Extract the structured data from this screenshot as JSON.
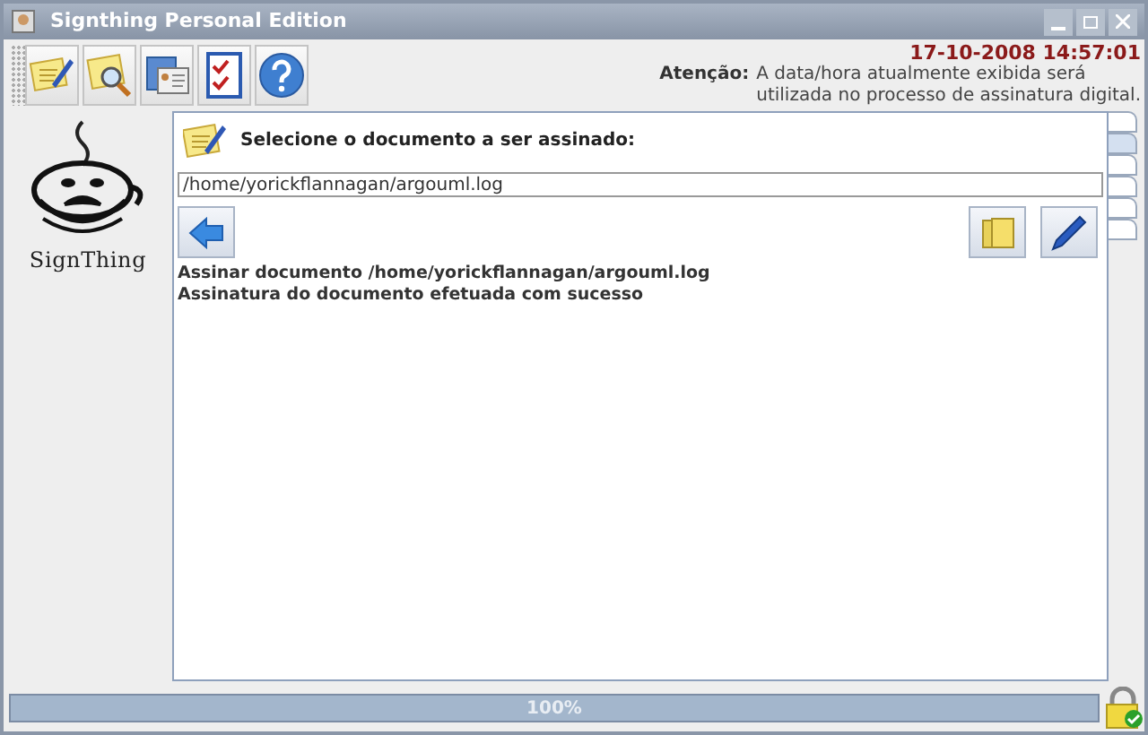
{
  "window": {
    "title": "Signthing Personal Edition"
  },
  "toolbar": [
    {
      "kind": "edit"
    },
    {
      "kind": "search"
    },
    {
      "kind": "cards"
    },
    {
      "kind": "checklist"
    },
    {
      "kind": "help"
    }
  ],
  "header": {
    "datetime": "17-10-2008 14:57:01",
    "notice_label": "Atenção:",
    "notice_line_1": "A data/hora atualmente exibida será",
    "notice_line_2": "utilizada no processo de assinatura digital."
  },
  "logo": {
    "text": "SignThing"
  },
  "panel": {
    "prompt": "Selecione o documento a ser assinado:",
    "file_path": "/home/yorickflannagan/argouml.log",
    "log": [
      "Assinar documento /home/yorickflannagan/argouml.log",
      "Assinatura do documento efetuada com sucesso"
    ]
  },
  "side_tabs": [
    {
      "selected": false
    },
    {
      "selected": true
    },
    {
      "selected": false
    },
    {
      "selected": false
    },
    {
      "selected": false
    },
    {
      "selected": false
    }
  ],
  "progress": {
    "level": 1,
    "text": "100%"
  }
}
